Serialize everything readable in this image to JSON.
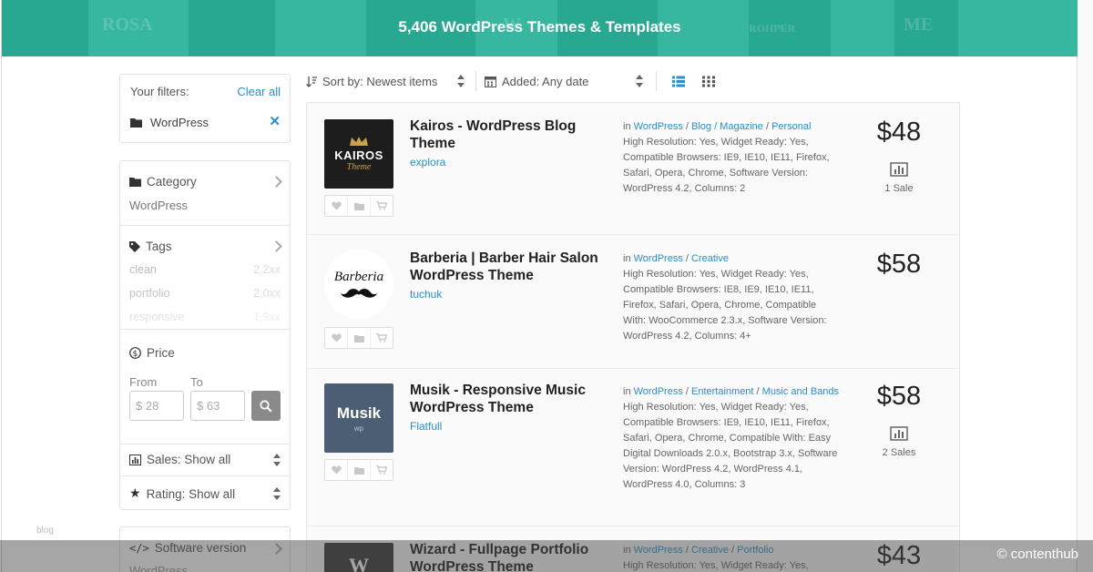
{
  "banner": {
    "title": "5,406 WordPress Themes & Templates",
    "bg_words": [
      "ROSA",
      "W",
      "ROHPER",
      "ME"
    ],
    "color": "#2bb399"
  },
  "sidebar": {
    "filters": {
      "label": "Your filters:",
      "clear_label": "Clear all",
      "active": [
        {
          "label": "WordPress",
          "icon": "folder-icon"
        }
      ]
    },
    "category": {
      "label": "Category",
      "value": "WordPress",
      "icon": "folder-icon"
    },
    "tags": {
      "label": "Tags",
      "icon": "tag-icon",
      "items": [
        {
          "name": "clean",
          "count": "2,2xx"
        },
        {
          "name": "portfolio",
          "count": "2,0xx"
        },
        {
          "name": "responsive",
          "count": "1,9xx"
        }
      ]
    },
    "price": {
      "label": "Price",
      "from_label": "From",
      "to_label": "To",
      "from_placeholder": "$ 28",
      "to_placeholder": "$ 63",
      "icon": "dollar-circle-icon"
    },
    "sales": {
      "label": "Sales: Show all",
      "icon": "bar-chart-icon"
    },
    "rating": {
      "label": "Rating: Show all",
      "icon": "star-icon"
    },
    "software": {
      "label": "Software version",
      "icon": "code-icon",
      "value": "WordPress"
    },
    "footer_word": "blog"
  },
  "toolbar": {
    "sort_label": "Sort by: Newest items",
    "date_label": "Added: Any date",
    "view_list": "list-view-icon",
    "view_grid": "grid-view-icon",
    "accent": "#2a8fc7"
  },
  "items": [
    {
      "title": "Kairos - WordPress Blog Theme",
      "author": "explora",
      "thumb_text": "KAIROS",
      "thumb_sub": "Theme",
      "category_prefix": "in ",
      "categories": [
        "WordPress",
        "Blog / Magazine",
        "Personal"
      ],
      "attributes": "High Resolution: Yes, Widget Ready: Yes, Compatible Browsers: IE9, IE10, IE11, Firefox, Safari, Opera, Chrome, Software Version: WordPress 4.2, Columns: 2",
      "price": "$48",
      "sales": "1 Sale"
    },
    {
      "title": "Barberia | Barber Hair Salon WordPress Theme",
      "author": "tuchuk",
      "thumb_text": "Barberia",
      "category_prefix": "in ",
      "categories": [
        "WordPress",
        "Creative"
      ],
      "attributes": "High Resolution: Yes, Widget Ready: Yes, Compatible Browsers: IE8, IE9, IE10, IE11, Firefox, Safari, Opera, Chrome, Compatible With: WooCommerce 2.3.x, Software Version: WordPress 4.2, Columns: 4+",
      "price": "$58",
      "sales": ""
    },
    {
      "title": "Musik - Responsive Music WordPress Theme",
      "author": "Flatfull",
      "thumb_text": "Musik",
      "thumb_sub": "wp",
      "category_prefix": "in ",
      "categories": [
        "WordPress",
        "Entertainment",
        "Music and Bands"
      ],
      "attributes": "High Resolution: Yes, Widget Ready: Yes, Compatible Browsers: IE9, IE10, IE11, Firefox, Safari, Opera, Chrome, Compatible With: Easy Digital Downloads 2.0.x, Bootstrap 3.x, Software Version: WordPress 4.2, WordPress 4.1, WordPress 4.0, Columns: 3",
      "price": "$58",
      "sales": "2 Sales"
    },
    {
      "title": "Wizard - Fullpage Portfolio WordPress Theme",
      "author": "",
      "thumb_text": "W",
      "category_prefix": "in ",
      "categories": [
        "WordPress",
        "Creative",
        "Portfolio"
      ],
      "attributes": "High Resolution: Yes, Widget Ready: Yes,",
      "price": "$43",
      "sales": ""
    }
  ],
  "credit": "© contenthub"
}
